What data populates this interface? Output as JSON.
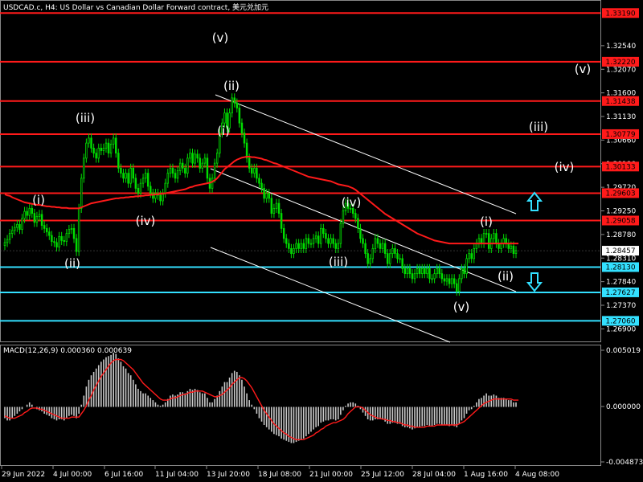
{
  "header": {
    "title": "USDCAD.c, H4:  US Dollar vs Canadian Dollar Forward contract, 美元兑加元"
  },
  "macd": {
    "title": "MACD(12,26,9) 0.000360 0.000639",
    "axis_labels": [
      "0.005019",
      "0.000000",
      "-0.004873"
    ],
    "ylim": [
      -0.004873,
      0.005019
    ]
  },
  "price_axis": {
    "ticks": [
      "1.32540",
      "1.32070",
      "1.31600",
      "1.31130",
      "1.30660",
      "1.30190",
      "1.29720",
      "1.29250",
      "1.28780",
      "1.28310",
      "1.27840",
      "1.27370",
      "1.26900"
    ],
    "ylim": [
      1.2665,
      1.3345
    ]
  },
  "levels": [
    {
      "value": "1.33190",
      "color": "#ff1a1a",
      "partial": true
    },
    {
      "value": "1.32220",
      "color": "#ff1a1a"
    },
    {
      "value": "1.31438",
      "color": "#ff1a1a"
    },
    {
      "value": "1.30779",
      "color": "#ff1a1a"
    },
    {
      "value": "1.30133",
      "color": "#ff1a1a"
    },
    {
      "value": "1.29603",
      "color": "#ff1a1a"
    },
    {
      "value": "1.29058",
      "color": "#ff1a1a"
    },
    {
      "value": "1.28130",
      "color": "#33e0ff"
    },
    {
      "value": "1.27627",
      "color": "#33e0ff"
    },
    {
      "value": "1.27060",
      "color": "#33e0ff"
    }
  ],
  "current_price": {
    "value": "1.28457"
  },
  "time_axis": [
    "29 Jun 2022",
    "4 Jul 00:00",
    "6 Jul 16:00",
    "11 Jul 04:00",
    "13 Jul 20:00",
    "18 Jul 08:00",
    "21 Jul 00:00",
    "25 Jul 12:00",
    "28 Jul 04:00",
    "1 Aug 16:00",
    "4 Aug 08:00"
  ],
  "wave_labels": [
    "(i)",
    "(ii)",
    "(iii)",
    "(iv)",
    "(v)",
    "(ii)",
    "(i)",
    "(iv)",
    "(iii)",
    "(v)",
    "(i)",
    "(ii)",
    "(v)",
    "(iii)",
    "(iv)"
  ],
  "arrows": {
    "up_color": "#33e0ff",
    "down_color": "#33e0ff",
    "up_icon": "arrow-up-outline",
    "down_icon": "arrow-down-outline"
  },
  "colors": {
    "candle": "#00dd00",
    "ma": "#ff1a1a",
    "channel": "#ffffff",
    "histogram": "#c8c8c8",
    "signal": "#ff1a1a"
  },
  "chart_data": {
    "type": "candlestick",
    "x": [
      0,
      1,
      2,
      3,
      4,
      5,
      6,
      7,
      8,
      9,
      10,
      11,
      12,
      13,
      14,
      15,
      16,
      17,
      18,
      19,
      20,
      21,
      22,
      23,
      24,
      25,
      26,
      27,
      28,
      29,
      30,
      31,
      32,
      33,
      34,
      35,
      36,
      37,
      38,
      39,
      40,
      41,
      42,
      43,
      44,
      45,
      46,
      47,
      48,
      49,
      50,
      51,
      52,
      53,
      54,
      55,
      56,
      57,
      58,
      59,
      60,
      61,
      62,
      63,
      64,
      65,
      66,
      67,
      68,
      69,
      70,
      71,
      72,
      73,
      74,
      75,
      76,
      77,
      78,
      79,
      80,
      81,
      82,
      83,
      84,
      85,
      86,
      87,
      88,
      89,
      90,
      91,
      92,
      93,
      94,
      95,
      96,
      97,
      98,
      99,
      100,
      101,
      102,
      103,
      104,
      105,
      106,
      107,
      108,
      109,
      110,
      111,
      112,
      113,
      114,
      115,
      116,
      117,
      118,
      119,
      120,
      121,
      122,
      123,
      124,
      125,
      126,
      127,
      128,
      129,
      130,
      131,
      132,
      133,
      134,
      135,
      136,
      137,
      138,
      139,
      140,
      141,
      142,
      143,
      144,
      145,
      146,
      147,
      148,
      149,
      150,
      151,
      152,
      153,
      154,
      155,
      156,
      157,
      158,
      159,
      160,
      161,
      162,
      163,
      164,
      165,
      166,
      167,
      168,
      169,
      170,
      171,
      172,
      173,
      174,
      175,
      176,
      177,
      178,
      179,
      180,
      181,
      182,
      183,
      184,
      185,
      186,
      187,
      188,
      189,
      190,
      191,
      192,
      193,
      194,
      195,
      196,
      197,
      198,
      199,
      200,
      201,
      202,
      203,
      204,
      205,
      206,
      207,
      208,
      209,
      210
    ],
    "close": [
      1.2862,
      1.2868,
      1.288,
      1.2886,
      1.2892,
      1.2898,
      1.2888,
      1.291,
      1.2924,
      1.2916,
      1.293,
      1.292,
      1.2902,
      1.2914,
      1.2918,
      1.2896,
      1.289,
      1.2883,
      1.2876,
      1.2864,
      1.2862,
      1.2853,
      1.2874,
      1.2866,
      1.2864,
      1.288,
      1.2888,
      1.289,
      1.287,
      1.2844,
      1.293,
      1.299,
      1.303,
      1.306,
      1.307,
      1.305,
      1.304,
      1.303,
      1.305,
      1.3045,
      1.305,
      1.306,
      1.304,
      1.3058,
      1.307,
      1.304,
      1.301,
      1.3,
      1.299,
      1.3,
      1.298,
      1.301,
      1.299,
      1.297,
      1.296,
      1.298,
      1.299,
      1.3,
      1.2974,
      1.296,
      1.295,
      1.296,
      1.2956,
      1.2945,
      1.296,
      1.298,
      1.3,
      1.301,
      1.3,
      1.299,
      1.3005,
      1.302,
      1.301,
      1.3,
      1.303,
      1.304,
      1.302,
      1.3038,
      1.303,
      1.301,
      1.302,
      1.303,
      1.299,
      1.297,
      1.299,
      1.302,
      1.304,
      1.308,
      1.31,
      1.312,
      1.309,
      1.312,
      1.315,
      1.314,
      1.313,
      1.31,
      1.308,
      1.306,
      1.303,
      1.301,
      1.3,
      1.301,
      1.299,
      1.298,
      1.297,
      1.295,
      1.296,
      1.295,
      1.292,
      1.293,
      1.294,
      1.292,
      1.289,
      1.287,
      1.286,
      1.285,
      1.284,
      1.285,
      1.286,
      1.285,
      1.286,
      1.285,
      1.287,
      1.286,
      1.286,
      1.287,
      1.2875,
      1.286,
      1.289,
      1.288,
      1.287,
      1.286,
      1.287,
      1.286,
      1.285,
      1.286,
      1.29,
      1.2925,
      1.294,
      1.293,
      1.293,
      1.292,
      1.291,
      1.289,
      1.287,
      1.286,
      1.284,
      1.282,
      1.283,
      1.285,
      1.287,
      1.286,
      1.285,
      1.286,
      1.284,
      1.282,
      1.284,
      1.285,
      1.284,
      1.283,
      1.283,
      1.281,
      1.28,
      1.281,
      1.28,
      1.279,
      1.28,
      1.281,
      1.28,
      1.281,
      1.28,
      1.281,
      1.279,
      1.279,
      1.28,
      1.281,
      1.28,
      1.279,
      1.2785,
      1.279,
      1.278,
      1.279,
      1.278,
      1.2765,
      1.279,
      1.281,
      1.28,
      1.283,
      1.284,
      1.283,
      1.285,
      1.286,
      1.287,
      1.286,
      1.288,
      1.288,
      1.285,
      1.287,
      1.288,
      1.286,
      1.285,
      1.286,
      1.287,
      1.286,
      1.285,
      1.2855,
      1.284,
      1.2846
    ],
    "open": [
      1.2856,
      1.2862,
      1.2868,
      1.288,
      1.2886,
      1.2892,
      1.2898,
      1.2888,
      1.291,
      1.2924,
      1.2916,
      1.293,
      1.292,
      1.2902,
      1.2914,
      1.2918,
      1.2896,
      1.289,
      1.2883,
      1.2876,
      1.2864,
      1.2862,
      1.2853,
      1.2874,
      1.2866,
      1.2864,
      1.288,
      1.2888,
      1.289,
      1.287,
      1.2844,
      1.293,
      1.299,
      1.303,
      1.306,
      1.307,
      1.305,
      1.304,
      1.303,
      1.305,
      1.3045,
      1.305,
      1.306,
      1.304,
      1.3058,
      1.307,
      1.304,
      1.301,
      1.3,
      1.299,
      1.3,
      1.298,
      1.301,
      1.299,
      1.297,
      1.296,
      1.298,
      1.299,
      1.3,
      1.2974,
      1.296,
      1.295,
      1.296,
      1.2956,
      1.2945,
      1.296,
      1.298,
      1.3,
      1.301,
      1.3,
      1.299,
      1.3005,
      1.302,
      1.301,
      1.3,
      1.303,
      1.304,
      1.302,
      1.3038,
      1.303,
      1.301,
      1.302,
      1.303,
      1.299,
      1.297,
      1.299,
      1.302,
      1.304,
      1.308,
      1.31,
      1.312,
      1.309,
      1.312,
      1.315,
      1.314,
      1.313,
      1.31,
      1.308,
      1.306,
      1.303,
      1.301,
      1.3,
      1.301,
      1.299,
      1.298,
      1.297,
      1.295,
      1.296,
      1.295,
      1.292,
      1.293,
      1.294,
      1.292,
      1.289,
      1.287,
      1.286,
      1.285,
      1.284,
      1.285,
      1.286,
      1.285,
      1.286,
      1.285,
      1.287,
      1.286,
      1.286,
      1.287,
      1.2875,
      1.286,
      1.289,
      1.288,
      1.287,
      1.286,
      1.287,
      1.286,
      1.285,
      1.286,
      1.29,
      1.2925,
      1.294,
      1.293,
      1.293,
      1.292,
      1.291,
      1.289,
      1.287,
      1.286,
      1.284,
      1.282,
      1.283,
      1.285,
      1.287,
      1.286,
      1.285,
      1.286,
      1.284,
      1.282,
      1.284,
      1.285,
      1.284,
      1.283,
      1.283,
      1.281,
      1.28,
      1.281,
      1.28,
      1.279,
      1.28,
      1.281,
      1.28,
      1.281,
      1.28,
      1.281,
      1.279,
      1.279,
      1.28,
      1.281,
      1.28,
      1.279,
      1.2785,
      1.279,
      1.278,
      1.279,
      1.278,
      1.2765,
      1.279,
      1.281,
      1.28,
      1.283,
      1.284,
      1.283,
      1.285,
      1.286,
      1.287,
      1.286,
      1.288,
      1.288,
      1.285,
      1.287,
      1.288,
      1.286,
      1.285,
      1.286,
      1.287,
      1.286,
      1.285,
      1.2855,
      1.284
    ],
    "ma": [
      1.2958,
      1.2956,
      1.2955,
      1.2952,
      1.295,
      1.2948,
      1.2946,
      1.2944,
      1.2942,
      1.2941,
      1.294,
      1.2939,
      1.2938,
      1.2937,
      1.2937,
      1.2936,
      1.2935,
      1.2934,
      1.2934,
      1.2933,
      1.2933,
      1.2932,
      1.2932,
      1.2931,
      1.2931,
      1.2931,
      1.293,
      1.293,
      1.293,
      1.293,
      1.293,
      1.2932,
      1.2934,
      1.2936,
      1.2938,
      1.294,
      1.2941,
      1.2942,
      1.2943,
      1.2944,
      1.2945,
      1.2946,
      1.2947,
      1.2948,
      1.2949,
      1.295,
      1.295,
      1.2951,
      1.2951,
      1.2952,
      1.2952,
      1.2953,
      1.2953,
      1.2954,
      1.2954,
      1.2955,
      1.2955,
      1.2956,
      1.2956,
      1.2957,
      1.2957,
      1.2958,
      1.2958,
      1.2959,
      1.2959,
      1.296,
      1.2961,
      1.2962,
      1.2963,
      1.2964,
      1.2965,
      1.2966,
      1.2967,
      1.2968,
      1.297,
      1.2972,
      1.2973,
      1.2975,
      1.2976,
      1.2977,
      1.2978,
      1.2979,
      1.298,
      1.2981,
      1.2983,
      1.2986,
      1.299,
      1.2996,
      1.3002,
      1.3008,
      1.3012,
      1.3016,
      1.302,
      1.3024,
      1.3027,
      1.3029,
      1.3031,
      1.3032,
      1.3033,
      1.3033,
      1.3032,
      1.3032,
      1.3031,
      1.303,
      1.3029,
      1.3027,
      1.3026,
      1.3024,
      1.3022,
      1.302,
      1.3019,
      1.3017,
      1.3015,
      1.3013,
      1.3011,
      1.3009,
      1.3007,
      1.3005,
      1.3003,
      1.3001,
      1.2999,
      1.2997,
      1.2995,
      1.2993,
      1.2992,
      1.2991,
      1.299,
      1.2989,
      1.2988,
      1.2987,
      1.2986,
      1.2985,
      1.2984,
      1.2982,
      1.298,
      1.2978,
      1.2977,
      1.2976,
      1.2975,
      1.2974,
      1.2972,
      1.297,
      1.2967,
      1.2963,
      1.2959,
      1.2955,
      1.2951,
      1.2947,
      1.2943,
      1.2939,
      1.2935,
      1.2931,
      1.2927,
      1.2923,
      1.2919,
      1.2916,
      1.2913,
      1.291,
      1.2907,
      1.2904,
      1.2901,
      1.2898,
      1.2895,
      1.2892,
      1.2889,
      1.2886,
      1.2883,
      1.288,
      1.2878,
      1.2876,
      1.2874,
      1.2872,
      1.287,
      1.2868,
      1.2866,
      1.2865,
      1.2864,
      1.2863,
      1.2862,
      1.2861,
      1.286,
      1.286,
      1.286,
      1.286,
      1.286,
      1.286,
      1.286,
      1.286,
      1.286,
      1.286,
      1.286,
      1.286,
      1.286,
      1.286,
      1.286,
      1.286,
      1.286,
      1.286,
      1.286,
      1.286,
      1.286,
      1.286,
      1.286,
      1.286,
      1.286,
      1.286,
      1.286,
      1.286,
      1.286
    ],
    "macd": [
      -0.001,
      -0.0012,
      -0.0012,
      -0.001,
      -0.0008,
      -0.0006,
      -0.0004,
      -0.0002,
      0.0,
      0.0002,
      0.0004,
      0.0002,
      0.0,
      -0.0002,
      -0.0003,
      -0.0004,
      -0.0006,
      -0.0007,
      -0.0008,
      -0.001,
      -0.0011,
      -0.0012,
      -0.0011,
      -0.0011,
      -0.0012,
      -0.001,
      -0.0008,
      -0.0007,
      -0.0008,
      -0.001,
      -0.0006,
      0.0002,
      0.001,
      0.0018,
      0.0024,
      0.0028,
      0.0031,
      0.0034,
      0.0037,
      0.004,
      0.0042,
      0.0044,
      0.0045,
      0.0046,
      0.0048,
      0.0047,
      0.0043,
      0.004,
      0.0036,
      0.0034,
      0.003,
      0.0028,
      0.0024,
      0.002,
      0.0016,
      0.0014,
      0.0012,
      0.0012,
      0.001,
      0.0008,
      0.0006,
      0.0004,
      0.0002,
      0.0001,
      0.0002,
      0.0004,
      0.0007,
      0.001,
      0.0011,
      0.001,
      0.0011,
      0.0013,
      0.0013,
      0.0012,
      0.0014,
      0.0016,
      0.0015,
      0.0016,
      0.0015,
      0.0013,
      0.0012,
      0.0012,
      0.0008,
      0.0004,
      0.0004,
      0.0007,
      0.001,
      0.0014,
      0.0018,
      0.0022,
      0.0022,
      0.0026,
      0.003,
      0.0032,
      0.0031,
      0.0028,
      0.0024,
      0.0018,
      0.0012,
      0.0006,
      0.0002,
      -0.0002,
      -0.0006,
      -0.001,
      -0.0013,
      -0.0016,
      -0.0018,
      -0.002,
      -0.0022,
      -0.0024,
      -0.0025,
      -0.0026,
      -0.0028,
      -0.0029,
      -0.003,
      -0.0031,
      -0.0032,
      -0.0032,
      -0.0031,
      -0.003,
      -0.0029,
      -0.0028,
      -0.0026,
      -0.0024,
      -0.0022,
      -0.002,
      -0.0018,
      -0.0017,
      -0.0014,
      -0.0013,
      -0.0012,
      -0.0012,
      -0.0011,
      -0.0011,
      -0.0012,
      -0.0011,
      -0.0007,
      -0.0003,
      0.0001,
      0.0003,
      0.0004,
      0.0004,
      0.0003,
      0.0001,
      -0.0002,
      -0.0005,
      -0.0008,
      -0.0011,
      -0.0012,
      -0.0012,
      -0.0011,
      -0.0011,
      -0.0011,
      -0.0011,
      -0.0013,
      -0.0015,
      -0.0015,
      -0.0014,
      -0.0014,
      -0.0015,
      -0.0015,
      -0.0017,
      -0.0018,
      -0.0018,
      -0.0019,
      -0.002,
      -0.0019,
      -0.0018,
      -0.0018,
      -0.0017,
      -0.0017,
      -0.0016,
      -0.0017,
      -0.0017,
      -0.0016,
      -0.0015,
      -0.0015,
      -0.0016,
      -0.0016,
      -0.0016,
      -0.0017,
      -0.0016,
      -0.0017,
      -0.0018,
      -0.0015,
      -0.0012,
      -0.001,
      -0.0006,
      -0.0003,
      -0.0002,
      0.0001,
      0.0004,
      0.0007,
      0.0008,
      0.001,
      0.0012,
      0.001,
      0.001,
      0.0011,
      0.001,
      0.0008,
      0.0008,
      0.0008,
      0.0007,
      0.0006,
      0.0006,
      0.0004,
      0.0004
    ],
    "signal": [
      -0.0008,
      -0.0009,
      -0.001,
      -0.001,
      -0.001,
      -0.0009,
      -0.0008,
      -0.0007,
      -0.0005,
      -0.0004,
      -0.0002,
      -0.0001,
      -0.0001,
      -0.0001,
      -0.0002,
      -0.0002,
      -0.0003,
      -0.0004,
      -0.0005,
      -0.0006,
      -0.0007,
      -0.0008,
      -0.0009,
      -0.001,
      -0.001,
      -0.001,
      -0.001,
      -0.0009,
      -0.0009,
      -0.0009,
      -0.0009,
      -0.0006,
      -0.0003,
      0.0001,
      0.0006,
      0.001,
      0.0015,
      0.0019,
      0.0023,
      0.0027,
      0.003,
      0.0033,
      0.0036,
      0.0039,
      0.0041,
      0.0042,
      0.0042,
      0.0042,
      0.0041,
      0.0039,
      0.0037,
      0.0035,
      0.0033,
      0.003,
      0.0027,
      0.0024,
      0.0021,
      0.0019,
      0.0017,
      0.0015,
      0.0013,
      0.0011,
      0.0009,
      0.0007,
      0.0006,
      0.0006,
      0.0006,
      0.0007,
      0.0008,
      0.0008,
      0.0009,
      0.001,
      0.0011,
      0.0011,
      0.0012,
      0.0013,
      0.0013,
      0.0014,
      0.0014,
      0.0014,
      0.0014,
      0.0013,
      0.0012,
      0.0011,
      0.001,
      0.0009,
      0.0009,
      0.001,
      0.0011,
      0.0013,
      0.0015,
      0.0017,
      0.002,
      0.0022,
      0.0024,
      0.0026,
      0.0026,
      0.0025,
      0.0023,
      0.002,
      0.0017,
      0.0013,
      0.0009,
      0.0005,
      0.0001,
      -0.0003,
      -0.0006,
      -0.0009,
      -0.0012,
      -0.0015,
      -0.0017,
      -0.0019,
      -0.0021,
      -0.0023,
      -0.0024,
      -0.0026,
      -0.0027,
      -0.0028,
      -0.0029,
      -0.0029,
      -0.0029,
      -0.0029,
      -0.0028,
      -0.0027,
      -0.0026,
      -0.0025,
      -0.0023,
      -0.0022,
      -0.002,
      -0.0019,
      -0.0017,
      -0.0016,
      -0.0015,
      -0.0014,
      -0.0014,
      -0.0013,
      -0.0012,
      -0.0011,
      -0.0009,
      -0.0006,
      -0.0004,
      -0.0002,
      0.0,
      0.0,
      0.0,
      -0.0001,
      -0.0003,
      -0.0005,
      -0.0007,
      -0.0008,
      -0.0009,
      -0.001,
      -0.001,
      -0.0011,
      -0.0011,
      -0.0012,
      -0.0012,
      -0.0013,
      -0.0013,
      -0.0014,
      -0.0014,
      -0.0015,
      -0.0016,
      -0.0016,
      -0.0017,
      -0.0017,
      -0.0018,
      -0.0018,
      -0.0018,
      -0.0018,
      -0.0018,
      -0.0017,
      -0.0017,
      -0.0017,
      -0.0017,
      -0.0016,
      -0.0016,
      -0.0016,
      -0.0016,
      -0.0016,
      -0.0016,
      -0.0016,
      -0.0016,
      -0.0016,
      -0.0015,
      -0.0014,
      -0.0013,
      -0.0011,
      -0.0009,
      -0.0007,
      -0.0005,
      -0.0003,
      -0.0001,
      0.0001,
      0.0003,
      0.0004,
      0.0005,
      0.0006,
      0.0007,
      0.0007,
      0.0007,
      0.0007,
      0.0007,
      0.0007,
      0.0007,
      0.0007,
      0.0006,
      0.0006,
      0.0006
    ]
  }
}
